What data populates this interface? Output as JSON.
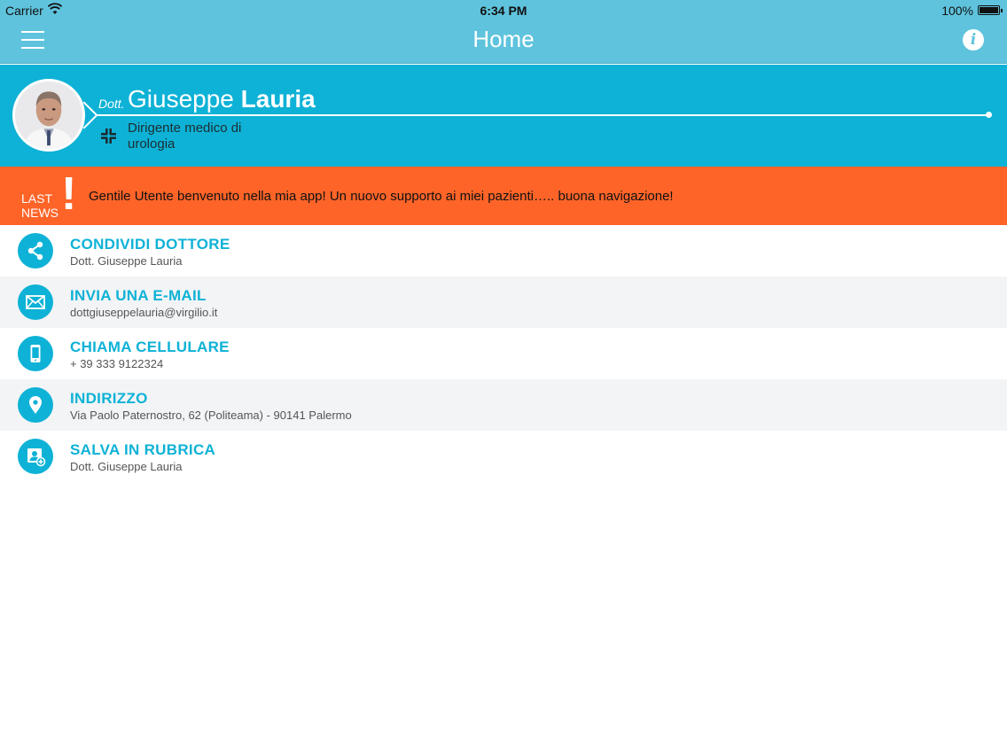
{
  "status_bar": {
    "carrier": "Carrier",
    "time": "6:34 PM",
    "battery": "100%"
  },
  "nav": {
    "title": "Home",
    "menu_icon": "hamburger-menu-icon",
    "info_icon": "info-icon",
    "info_glyph": "i"
  },
  "profile": {
    "prefix": "Dott.",
    "first_name": "Giuseppe",
    "last_name": "Lauria",
    "role": "Dirigente medico di urologia",
    "specialty_icon": "medical-cross-icon"
  },
  "news": {
    "label_line1": "LAST",
    "label_line2": "NEWS",
    "mark": "!",
    "text": "Gentile Utente benvenuto nella mia app! Un nuovo supporto ai miei pazienti….. buona navigazione!"
  },
  "actions": [
    {
      "icon": "share-icon",
      "title": "CONDIVIDI DOTTORE",
      "subtitle": "Dott. Giuseppe Lauria"
    },
    {
      "icon": "envelope-icon",
      "title": "INVIA UNA E-MAIL",
      "subtitle": "dottgiuseppelauria@virgilio.it"
    },
    {
      "icon": "mobile-phone-icon",
      "title": "CHIAMA CELLULARE",
      "subtitle": "+ 39 333 9122324"
    },
    {
      "icon": "location-pin-icon",
      "title": "INDIRIZZO",
      "subtitle": "Via Paolo Paternostro, 62 (Politeama) - 90141 Palermo"
    },
    {
      "icon": "add-contact-icon",
      "title": "SALVA IN RUBRICA",
      "subtitle": "Dott. Giuseppe Lauria"
    }
  ],
  "colors": {
    "nav_bar": "#5fc3dd",
    "profile_bg": "#0eb2d6",
    "news_bg": "#fe6428",
    "accent": "#0eb2d6"
  }
}
